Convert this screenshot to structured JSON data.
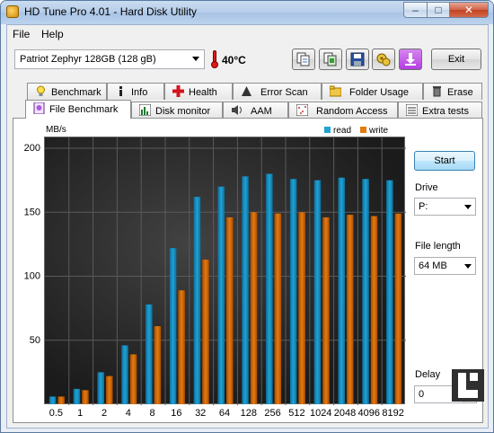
{
  "window": {
    "title": "HD Tune Pro 4.01 - Hard Disk Utility",
    "controls": {
      "minimize": "–",
      "maximize": "□",
      "close": "✕"
    }
  },
  "menu": {
    "file": "File",
    "help": "Help"
  },
  "toolbar": {
    "drive": "Patriot Zephyr 128GB   (128 gB)",
    "temperature": "40°C",
    "buttons": [
      "copy-info-icon",
      "copy-screenshot-icon",
      "save-icon",
      "options-icon",
      "download-icon"
    ],
    "exit_label": "Exit"
  },
  "tabs_top": [
    "Benchmark",
    "Info",
    "Health",
    "Error Scan",
    "Folder Usage",
    "Erase"
  ],
  "tabs_bottom": [
    "File Benchmark",
    "Disk monitor",
    "AAM",
    "Random Access",
    "Extra tests"
  ],
  "side": {
    "start_label": "Start",
    "drive_label": "Drive",
    "drive_value": "P:",
    "file_length_label": "File length",
    "file_length_value": "64 MB",
    "delay_label": "Delay",
    "delay_value": "0"
  },
  "chart_data": {
    "type": "bar",
    "ylabel": "MB/s",
    "ylim": [
      0,
      200
    ],
    "yticks": [
      50,
      100,
      150,
      200
    ],
    "categories": [
      "0.5",
      "1",
      "2",
      "4",
      "8",
      "16",
      "32",
      "64",
      "128",
      "256",
      "512",
      "1024",
      "2048",
      "4096",
      "8192"
    ],
    "series": [
      {
        "name": "read",
        "color": "#1fa2d6",
        "values": [
          6,
          12,
          25,
          46,
          78,
          122,
          162,
          170,
          178,
          180,
          176,
          175,
          177,
          176,
          175
        ]
      },
      {
        "name": "write",
        "color": "#e57a0f",
        "values": [
          6,
          11,
          22,
          39,
          61,
          89,
          113,
          146,
          150,
          149,
          150,
          146,
          148,
          147,
          149
        ]
      }
    ],
    "grid": true,
    "legend": "top-right"
  }
}
